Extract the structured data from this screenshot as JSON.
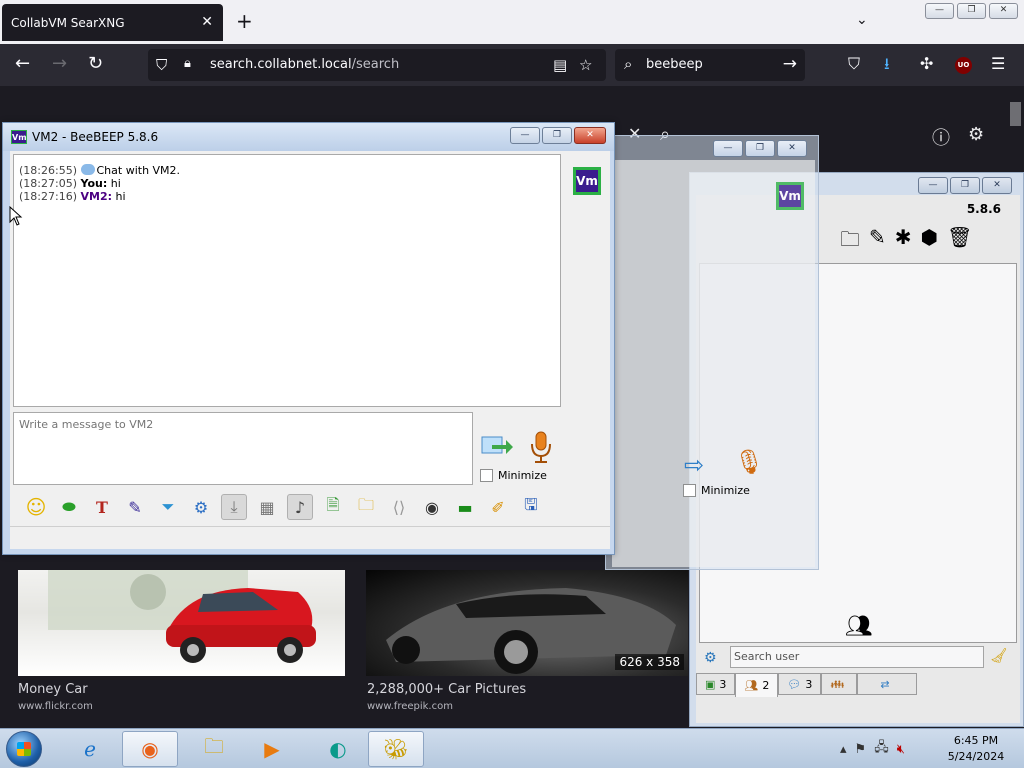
{
  "browser": {
    "tab_title": "CollabVM SearXNG",
    "tab_close": "✕",
    "new_tab": "+",
    "url_host": "search.collabnet.local",
    "url_path": "/search",
    "search_text": "beebeep",
    "ublock_label": "UO"
  },
  "window_controls": {
    "minimize": "—",
    "restore": "❐",
    "close": "✕"
  },
  "results": [
    {
      "title": "Money Car",
      "source": "www.flickr.com"
    },
    {
      "title": "2,288,000+ Car Pictures",
      "source": "www.freepik.com",
      "size": "626 x 358"
    }
  ],
  "chat_window": {
    "title": "VM2 - BeeBEEP 5.8.6",
    "avatar": "Vm",
    "messages": [
      {
        "time": "(18:26:55)",
        "kind": "system",
        "text": "Chat with VM2."
      },
      {
        "time": "(18:27:05)",
        "kind": "you",
        "sender": "You:",
        "text": "hi"
      },
      {
        "time": "(18:27:16)",
        "kind": "peer",
        "sender": "VM2:",
        "text": "hi"
      }
    ],
    "input_placeholder": "Write a message to VM2",
    "minimize_label": "Minimize"
  },
  "mid_window": {
    "minimize_label": "Minimize",
    "avatar": "Vm"
  },
  "main_window": {
    "version": "5.8.6",
    "search_placeholder": "Search user",
    "tabs": [
      {
        "icon": "users-online-icon",
        "count": "3"
      },
      {
        "icon": "contacts-icon",
        "count": "2"
      },
      {
        "icon": "chats-icon",
        "count": "3"
      },
      {
        "icon": "groups-icon",
        "count": ""
      },
      {
        "icon": "shares-icon",
        "count": ""
      }
    ]
  },
  "taskbar": {
    "time": "6:45 PM",
    "date": "5/24/2024"
  },
  "colors": {
    "vm_avatar_bg": "#3a1c8e",
    "vm_avatar_border": "#2bb045",
    "peer_name": "#4b0082"
  }
}
